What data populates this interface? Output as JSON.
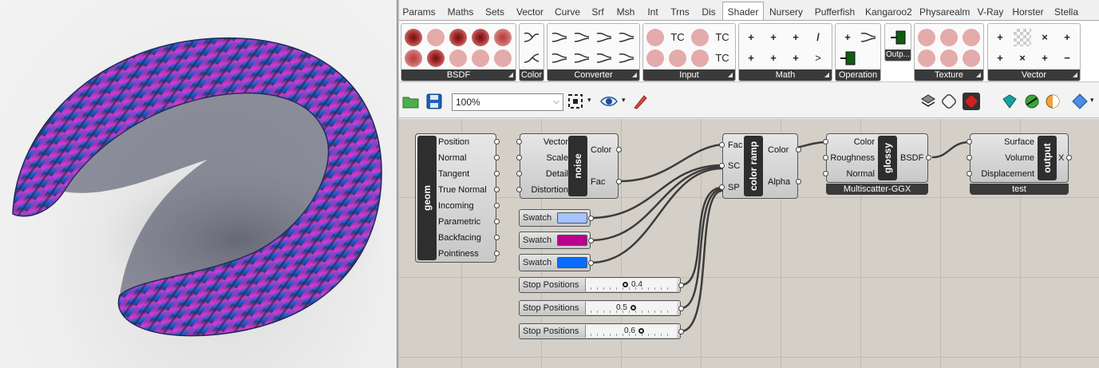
{
  "ribbon": {
    "tabs": [
      "Params",
      "Maths",
      "Sets",
      "Vector",
      "Curve",
      "Srf",
      "Msh",
      "Int",
      "Trns",
      "Dis",
      "Shader",
      "Nursery",
      "Pufferfish",
      "Kangaroo2",
      "Physarealm",
      "V-Ray",
      "Horster",
      "Stella"
    ],
    "active_tab": "Shader",
    "groups": {
      "bsdf": "BSDF",
      "color": "Color",
      "converter": "Converter",
      "input": "Input",
      "math": "Math",
      "operation": "Operation",
      "output": "Outp...",
      "texture": "Texture",
      "vector": "Vector"
    },
    "input_tc": "TC",
    "math_symbols": [
      "+",
      "+",
      "+",
      "/",
      "+",
      "+",
      "+",
      ">"
    ],
    "vector_symbols": [
      "+",
      "×",
      "+",
      "+",
      "×",
      "+",
      "−"
    ]
  },
  "toolbar": {
    "zoom": "100%"
  },
  "components": {
    "geom": {
      "name": "geom",
      "outputs": [
        "Position",
        "Normal",
        "Tangent",
        "True Normal",
        "Incoming",
        "Parametric",
        "Backfacing",
        "Pointiness"
      ]
    },
    "noise": {
      "name": "noise",
      "inputs": [
        "Vector",
        "Scale",
        "Detail",
        "Distortion"
      ],
      "outputs": [
        "Color",
        "Fac"
      ]
    },
    "color_ramp": {
      "name": "color ramp",
      "inputs": [
        "Fac",
        "SC",
        "SP"
      ],
      "outputs": [
        "Color",
        "Alpha"
      ]
    },
    "glossy": {
      "name": "glossy",
      "inputs": [
        "Color",
        "Roughness",
        "Normal"
      ],
      "outputs": [
        "BSDF"
      ],
      "subtitle": "Multiscatter-GGX"
    },
    "output": {
      "name": "output",
      "inputs": [
        "Surface",
        "Volume",
        "Displacement"
      ],
      "outputs": [
        "X"
      ],
      "subtitle": "test"
    }
  },
  "swatches": [
    {
      "label": "Swatch",
      "color": "#a5c3ff"
    },
    {
      "label": "Swatch",
      "color": "#b8008c"
    },
    {
      "label": "Swatch",
      "color": "#0a6cff"
    }
  ],
  "sliders": [
    {
      "label": "Stop Positions",
      "value": "0.4"
    },
    {
      "label": "Stop Positions",
      "value": "0.5"
    },
    {
      "label": "Stop Positions",
      "value": "0.6"
    }
  ],
  "colors": {
    "component_core": "#2e2e2e",
    "canvas": "#d4d0c8",
    "panel_footer": "#3a3a3a"
  }
}
